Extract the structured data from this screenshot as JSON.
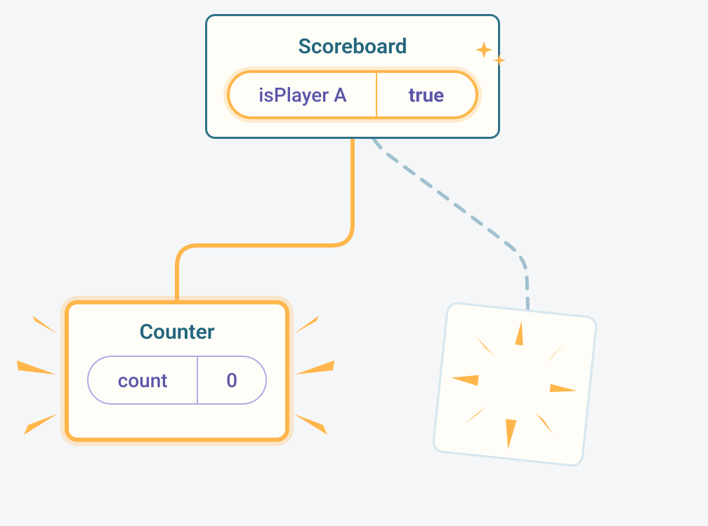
{
  "scoreboard": {
    "title": "Scoreboard",
    "pill": {
      "label": "isPlayer A",
      "value": "true"
    }
  },
  "counter": {
    "title": "Counter",
    "pill": {
      "label": "count",
      "value": "0"
    }
  },
  "colors": {
    "border_teal": "#2F7289",
    "accent_orange": "#FFB64B",
    "accent_orange_glow": "rgba(255,182,75,0.25)",
    "pill_violet": "#B5A8E8",
    "text_violet": "#5B56A9",
    "dashed_blue": "#9FC0CE",
    "poof_border": "#D6E7EE",
    "card_bg": "#FEFDF8"
  }
}
